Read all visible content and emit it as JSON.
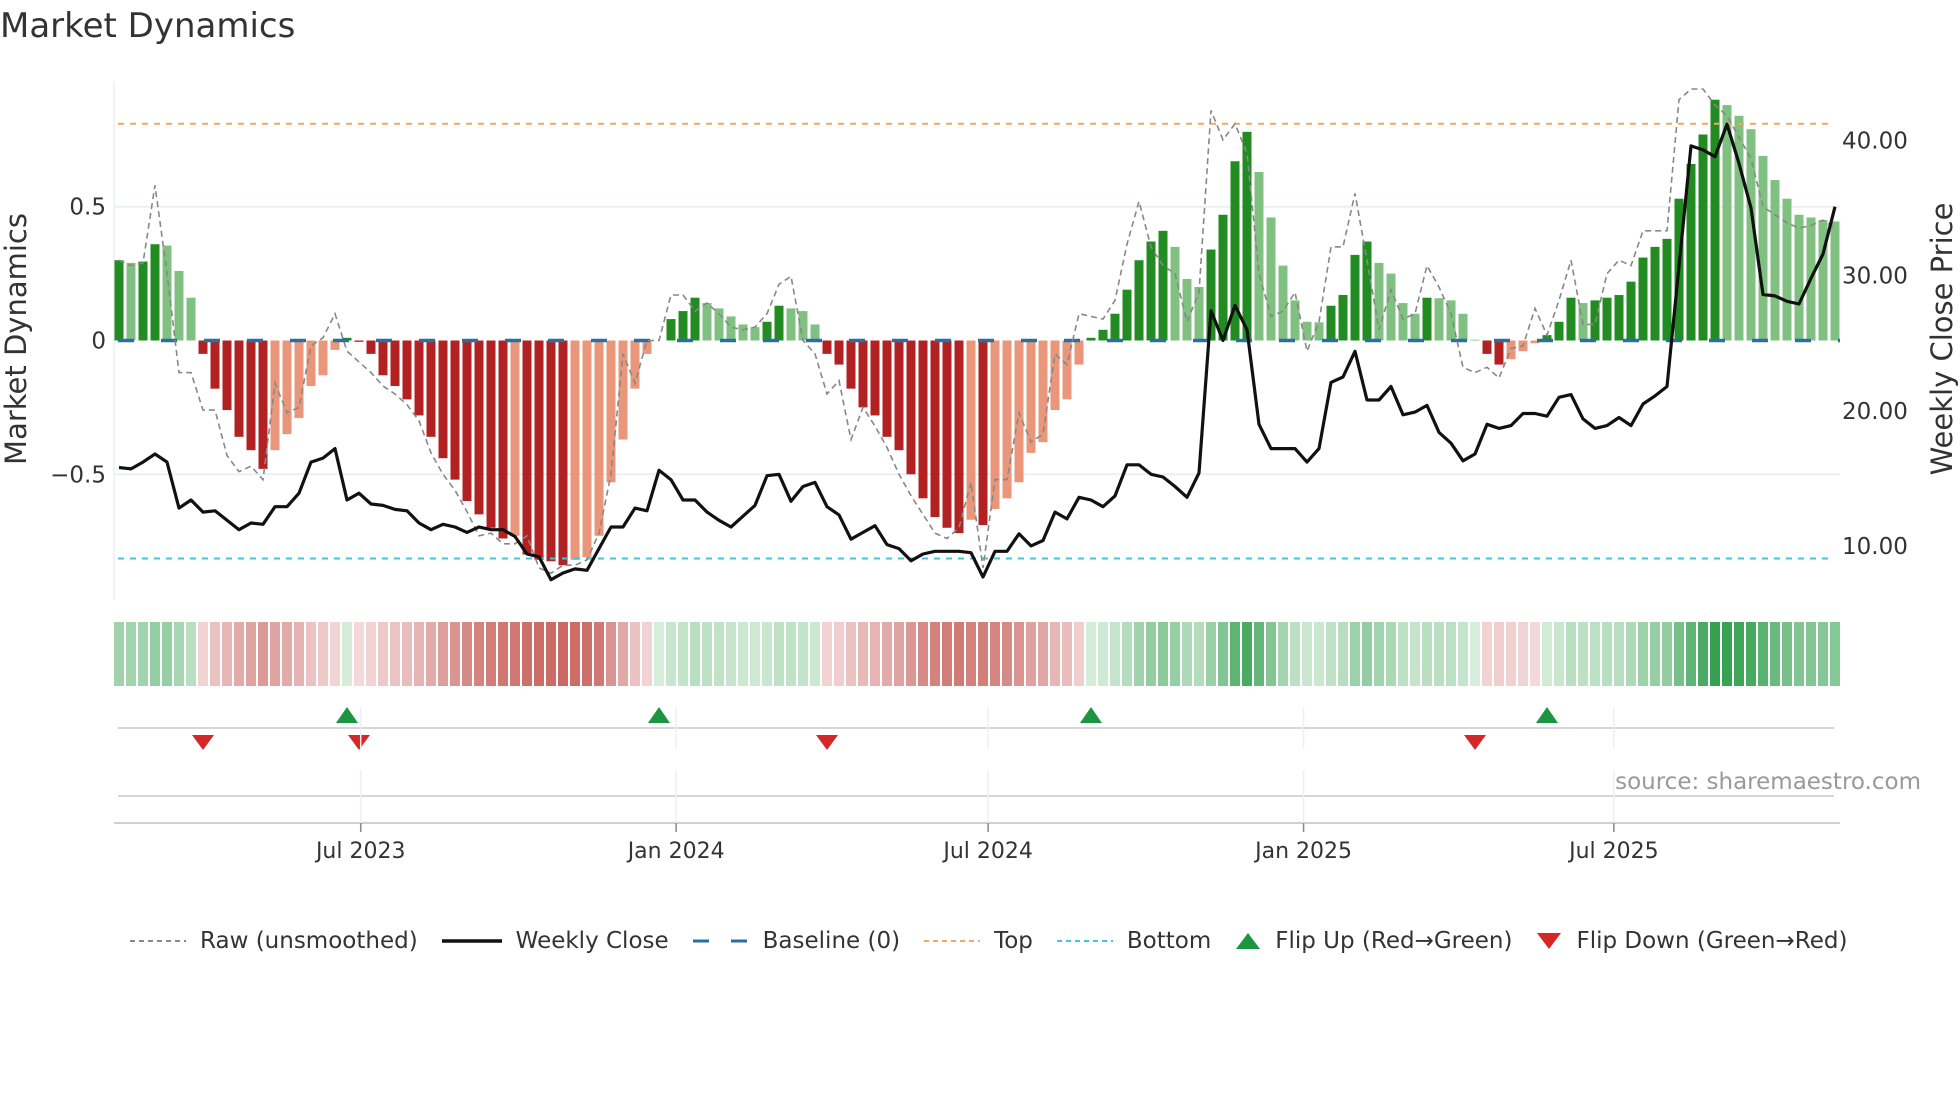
{
  "title": "Market Dynamics",
  "source": "source: sharemaestro.com",
  "legend": {
    "raw": "Raw (unsmoothed)",
    "close": "Weekly Close",
    "baseline": "Baseline (0)",
    "top": "Top",
    "bottom": "Bottom",
    "flip_up": "Flip Up (Red→Green)",
    "flip_down": "Flip Down (Green→Red)"
  },
  "colors": {
    "bar_up_strong": "#228b22",
    "bar_up_weak": "#80c080",
    "bar_down_strong": "#b22222",
    "bar_down_weak": "#e9967a",
    "raw": "#888888",
    "close": "#111111",
    "baseline": "#2c6e9e",
    "top": "#f0a868",
    "bottom": "#3fc6dc",
    "flip_up": "#1a9641",
    "flip_down": "#d62728",
    "grid": "#eceff3"
  },
  "chart_data": {
    "type": "bar+line",
    "title": "Market Dynamics",
    "ylabel": "Market Dynamics",
    "y2label": "Weekly Close Price",
    "frequency": "weekly",
    "start_date": "2023-02-10",
    "ylim": [
      -0.97,
      0.97
    ],
    "y2lim": [
      6.0,
      44.4
    ],
    "left_ticks": [
      {
        "v": 0.5,
        "label": "0.5"
      },
      {
        "v": 0,
        "label": "0"
      },
      {
        "v": -0.5,
        "label": "−0.5"
      }
    ],
    "right_ticks": [
      {
        "v": 40,
        "label": "40.00"
      },
      {
        "v": 30,
        "label": "30.00"
      },
      {
        "v": 20,
        "label": "20.00"
      },
      {
        "v": 10,
        "label": "10.00"
      }
    ],
    "x_ticks": [
      {
        "date": "2023-07-01",
        "label": "Jul 2023"
      },
      {
        "date": "2024-01-01",
        "label": "Jan 2024"
      },
      {
        "date": "2024-07-01",
        "label": "Jul 2024"
      },
      {
        "date": "2025-01-01",
        "label": "Jan 2025"
      },
      {
        "date": "2025-07-01",
        "label": "Jul 2025"
      }
    ],
    "top": 0.81,
    "bottom": -0.815,
    "baseline": 0,
    "momentum": [
      0.3,
      0.29,
      0.295,
      0.36,
      0.355,
      0.26,
      0.16,
      -0.05,
      -0.18,
      -0.26,
      -0.36,
      -0.41,
      -0.48,
      -0.41,
      -0.35,
      -0.29,
      -0.17,
      -0.13,
      -0.035,
      0.01,
      -0.005,
      -0.05,
      -0.13,
      -0.17,
      -0.22,
      -0.28,
      -0.36,
      -0.44,
      -0.52,
      -0.6,
      -0.65,
      -0.7,
      -0.74,
      -0.73,
      -0.8,
      -0.82,
      -0.825,
      -0.84,
      -0.82,
      -0.81,
      -0.73,
      -0.53,
      -0.37,
      -0.18,
      -0.05,
      0,
      0.08,
      0.11,
      0.16,
      0.14,
      0.12,
      0.09,
      0.06,
      0.05,
      0.07,
      0.13,
      0.12,
      0.11,
      0.06,
      -0.05,
      -0.09,
      -0.18,
      -0.25,
      -0.28,
      -0.36,
      -0.41,
      -0.5,
      -0.59,
      -0.66,
      -0.7,
      -0.72,
      -0.67,
      -0.69,
      -0.63,
      -0.59,
      -0.53,
      -0.42,
      -0.38,
      -0.26,
      -0.22,
      -0.09,
      0.01,
      0.04,
      0.1,
      0.19,
      0.3,
      0.37,
      0.41,
      0.35,
      0.23,
      0.2,
      0.34,
      0.47,
      0.67,
      0.78,
      0.63,
      0.46,
      0.28,
      0.15,
      0.07,
      0.068,
      0.13,
      0.17,
      0.32,
      0.37,
      0.29,
      0.25,
      0.14,
      0.1,
      0.16,
      0.158,
      0.15,
      0.1,
      0.003,
      -0.05,
      -0.09,
      -0.07,
      -0.04,
      -0.01,
      0.02,
      0.07,
      0.16,
      0.14,
      0.15,
      0.16,
      0.17,
      0.22,
      0.31,
      0.35,
      0.38,
      0.53,
      0.66,
      0.77,
      0.9,
      0.88,
      0.84,
      0.79,
      0.69,
      0.6,
      0.53,
      0.47,
      0.46,
      0.45,
      0.445
    ],
    "raw": [
      0.3,
      0.28,
      0.29,
      0.58,
      0.25,
      -0.12,
      -0.12,
      -0.26,
      -0.26,
      -0.43,
      -0.49,
      -0.47,
      -0.52,
      -0.16,
      -0.27,
      -0.25,
      -0.02,
      0.01,
      0.1,
      -0.04,
      -0.08,
      -0.12,
      -0.17,
      -0.2,
      -0.24,
      -0.3,
      -0.42,
      -0.5,
      -0.56,
      -0.64,
      -0.73,
      -0.72,
      -0.76,
      -0.76,
      -0.73,
      -0.85,
      -0.87,
      -0.84,
      -0.84,
      -0.82,
      -0.72,
      -0.5,
      -0.05,
      -0.16,
      0.0,
      0.0,
      0.17,
      0.17,
      0.11,
      0.14,
      0.1,
      0.05,
      0.04,
      0.05,
      0.1,
      0.21,
      0.24,
      0.0,
      -0.05,
      -0.2,
      -0.15,
      -0.37,
      -0.25,
      -0.32,
      -0.4,
      -0.5,
      -0.58,
      -0.65,
      -0.72,
      -0.74,
      -0.7,
      -0.53,
      -0.85,
      -0.52,
      -0.52,
      -0.27,
      -0.38,
      -0.35,
      -0.05,
      -0.09,
      0.1,
      0.09,
      0.08,
      0.15,
      0.36,
      0.52,
      0.35,
      0.28,
      0.25,
      0.07,
      0.18,
      0.86,
      0.75,
      0.81,
      0.7,
      0.25,
      0.09,
      0.11,
      0.18,
      -0.04,
      0.07,
      0.35,
      0.35,
      0.55,
      0.3,
      0.04,
      0.19,
      0.08,
      0.1,
      0.28,
      0.2,
      0.1,
      -0.1,
      -0.12,
      -0.1,
      -0.14,
      -0.03,
      -0.02,
      0.12,
      0.02,
      0.15,
      0.3,
      0.06,
      0.06,
      0.25,
      0.3,
      0.28,
      0.41,
      0.41,
      0.41,
      0.9,
      0.94,
      0.94,
      0.88,
      0.84,
      0.76,
      0.68,
      0.5,
      0.47,
      0.44,
      0.42,
      0.43,
      0.45,
      0.42
    ],
    "close": [
      15.8,
      15.7,
      16.2,
      16.8,
      16.2,
      12.8,
      13.4,
      12.5,
      12.6,
      11.9,
      11.2,
      11.7,
      11.6,
      12.9,
      12.9,
      13.9,
      16.2,
      16.5,
      17.2,
      13.4,
      13.9,
      13.1,
      13.0,
      12.7,
      12.6,
      11.7,
      11.2,
      11.6,
      11.4,
      11.0,
      11.4,
      11.2,
      11.2,
      10.7,
      9.4,
      9.2,
      7.5,
      8.0,
      8.3,
      8.2,
      9.8,
      11.4,
      11.4,
      12.8,
      12.6,
      15.6,
      14.9,
      13.4,
      13.4,
      12.5,
      11.9,
      11.4,
      12.2,
      13.0,
      15.2,
      15.3,
      13.3,
      14.4,
      14.7,
      12.9,
      12.3,
      10.5,
      11.0,
      11.5,
      10.1,
      9.8,
      8.9,
      9.4,
      9.6,
      9.6,
      9.6,
      9.5,
      7.7,
      9.6,
      9.6,
      10.9,
      10.0,
      10.4,
      12.5,
      12.0,
      13.6,
      13.4,
      12.9,
      13.7,
      16.0,
      16.0,
      15.3,
      15.1,
      14.4,
      13.6,
      15.4,
      27.4,
      25.2,
      27.8,
      26.0,
      19.0,
      17.2,
      17.2,
      17.2,
      16.2,
      17.2,
      22.1,
      22.5,
      24.4,
      20.8,
      20.8,
      21.8,
      19.7,
      19.9,
      20.4,
      18.4,
      17.6,
      16.3,
      16.8,
      19.0,
      18.7,
      18.9,
      19.8,
      19.8,
      19.6,
      21.0,
      21.2,
      19.4,
      18.7,
      18.9,
      19.5,
      18.9,
      20.5,
      21.1,
      21.8,
      30.7,
      39.6,
      39.3,
      38.8,
      41.2,
      38.3,
      35.0,
      28.6,
      28.5,
      28.1,
      27.9,
      29.8,
      31.6,
      35.1
    ],
    "flip_up_week_index": [
      19,
      45,
      81,
      119
    ],
    "flip_down_week_index": [
      7,
      20,
      59,
      113
    ],
    "legend_position": "bottom"
  }
}
